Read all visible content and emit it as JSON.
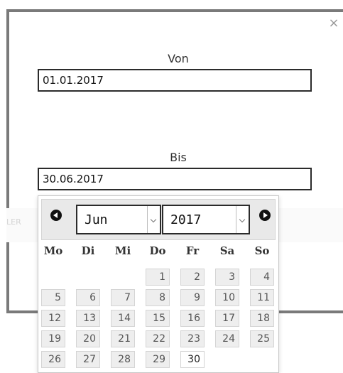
{
  "dialog": {
    "close_symbol": "×",
    "from": {
      "label": "Von",
      "value": "01.01.2017"
    },
    "to": {
      "label": "Bis",
      "value": "30.06.2017"
    },
    "background_hint": "LER"
  },
  "datepicker": {
    "prev_icon": "circle-prev-icon",
    "next_icon": "circle-next-icon",
    "month": "Jun",
    "year": "2017",
    "weekdays": [
      "Mo",
      "Di",
      "Mi",
      "Do",
      "Fr",
      "Sa",
      "So"
    ],
    "weeks": [
      [
        "",
        "",
        "",
        "1",
        "2",
        "3",
        "4"
      ],
      [
        "5",
        "6",
        "7",
        "8",
        "9",
        "10",
        "11"
      ],
      [
        "12",
        "13",
        "14",
        "15",
        "16",
        "17",
        "18"
      ],
      [
        "19",
        "20",
        "21",
        "22",
        "23",
        "24",
        "25"
      ],
      [
        "26",
        "27",
        "28",
        "29",
        "30",
        "",
        ""
      ]
    ],
    "selected_day": "30"
  }
}
